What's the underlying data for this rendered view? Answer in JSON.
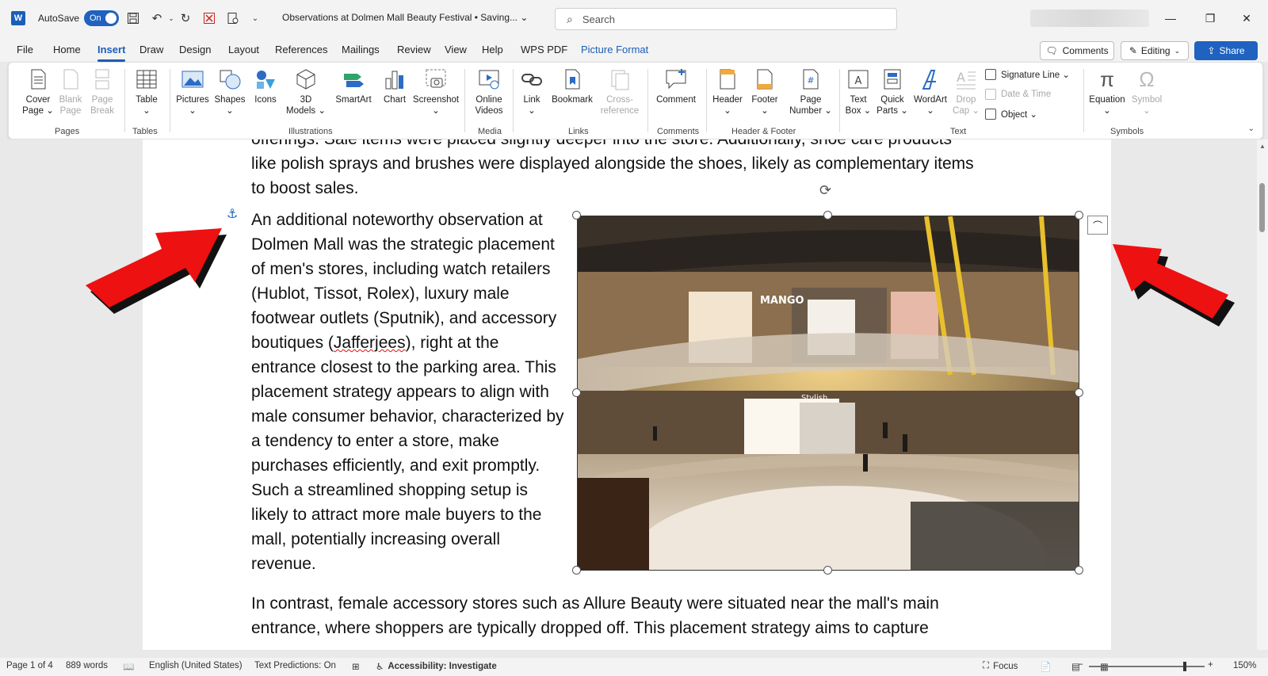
{
  "titlebar": {
    "word_icon": "word-logo-icon",
    "autosave_label": "AutoSave",
    "autosave_state": "On",
    "doc_title": "Observations at Dolmen Mall Beauty Festival • Saving... ⌄",
    "search_placeholder": "Search"
  },
  "menu": {
    "tabs": [
      "File",
      "Home",
      "Insert",
      "Draw",
      "Design",
      "Layout",
      "References",
      "Mailings",
      "Review",
      "View",
      "Help",
      "WPS PDF",
      "Picture Format"
    ],
    "active_tab": "Insert",
    "comments_label": "Comments",
    "editing_label": "Editing",
    "share_label": "Share"
  },
  "ribbon": {
    "pages": {
      "label": "Pages",
      "cover": "Cover\nPage ⌄",
      "blank": "Blank\nPage",
      "break": "Page\nBreak"
    },
    "tables": {
      "label": "Tables",
      "table": "Table\n⌄"
    },
    "illustrations": {
      "label": "Illustrations",
      "pictures": "Pictures\n⌄",
      "shapes": "Shapes\n⌄",
      "icons": "Icons",
      "models": "3D\nModels ⌄",
      "smartart": "SmartArt",
      "chart": "Chart",
      "screenshot": "Screenshot\n⌄"
    },
    "media": {
      "label": "Media",
      "online_videos": "Online\nVideos"
    },
    "links": {
      "label": "Links",
      "link": "Link\n⌄",
      "bookmark": "Bookmark",
      "crossref": "Cross-\nreference"
    },
    "comments": {
      "label": "Comments",
      "comment": "Comment"
    },
    "header_footer": {
      "label": "Header & Footer",
      "header": "Header\n⌄",
      "footer": "Footer\n⌄",
      "page_number": "Page\nNumber ⌄"
    },
    "text": {
      "label": "Text",
      "text_box": "Text\nBox ⌄",
      "quick_parts": "Quick\nParts ⌄",
      "wordart": "WordArt\n⌄",
      "drop_cap": "Drop\nCap ⌄",
      "signature_line": "Signature Line ⌄",
      "date_time": "Date & Time",
      "object": "Object ⌄"
    },
    "symbols": {
      "label": "Symbols",
      "equation": "Equation\n⌄",
      "symbol": "Symbol\n⌄"
    }
  },
  "document": {
    "p1": "offerings. Sale items were placed slightly deeper into the store. Additionally, shoe care products like polish sprays and brushes were displayed alongside the shoes, likely as complementary items to boost sales.",
    "p2_before": "An additional noteworthy observation at Dolmen Mall was the strategic placement of men's stores, including watch retailers (Hublot, Tissot, Rolex), luxury male footwear outlets (Sputnik), and accessory boutiques (",
    "p2_squiggle": "Jafferjees",
    "p2_after": "), right at the entrance closest to the parking area. This placement strategy appears to align with male consumer behavior, characterized by a tendency to enter a store, make purchases efficiently, and exit promptly. Such a streamlined shopping setup is likely to attract more male buyers to the mall, potentially increasing overall revenue.",
    "p3": "In contrast, female accessory stores such as Allure Beauty were situated near the mall's main entrance, where shoppers are typically dropped off. This placement strategy aims to capture",
    "photo_sign_1": "MANGO",
    "photo_sign_2": "Stylish"
  },
  "status": {
    "page": "Page 1 of 4",
    "words": "889 words",
    "language": "English (United States)",
    "predictions": "Text Predictions: On",
    "accessibility": "Accessibility: Investigate",
    "focus": "Focus",
    "zoom": "150%"
  },
  "colors": {
    "accent": "#1f62bf",
    "arrow": "#ee1111"
  }
}
